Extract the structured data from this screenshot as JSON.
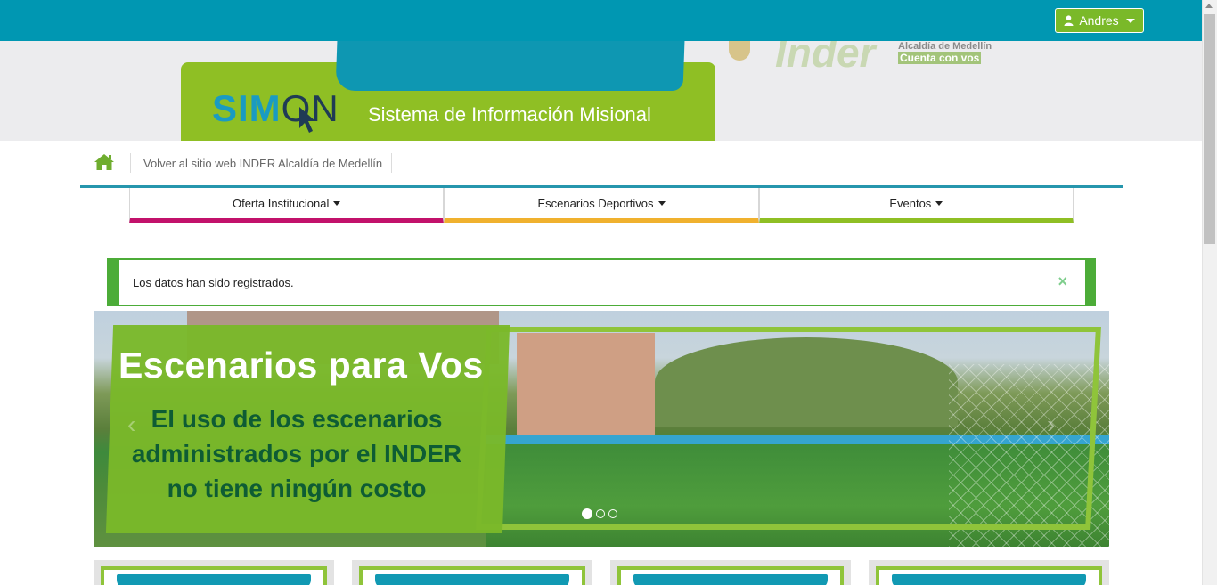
{
  "topbar": {
    "user_label": "Andres",
    "accent": "#0097b2",
    "user_button_color": "#7ab929"
  },
  "banner": {
    "logo_sim": "SIM",
    "logo_on": "ON",
    "subtitle": "Sistema de Información Misional",
    "inder_text": "Inder",
    "alcaldia_line1": "Alcaldía de Medellín",
    "alcaldia_line2": "Cuenta con vos"
  },
  "breadcrumb": {
    "home_icon": "home-icon",
    "back_link": "Volver al sitio web INDER Alcaldía de Medellín"
  },
  "nav": {
    "items": [
      {
        "label": "Oferta Institucional",
        "color": "#c2116b"
      },
      {
        "label": "Escenarios Deportivos",
        "color": "#f0b12e"
      },
      {
        "label": "Eventos",
        "color": "#8fbf24"
      }
    ]
  },
  "alert": {
    "message": "Los datos han sido registrados.",
    "close": "×"
  },
  "carousel": {
    "title": "Escenarios para Vos",
    "text": "El uso de los escenarios administrados por el INDER no tiene ningún costo",
    "prev": "‹",
    "next": "›",
    "slides_count": 3,
    "active_index": 0
  }
}
